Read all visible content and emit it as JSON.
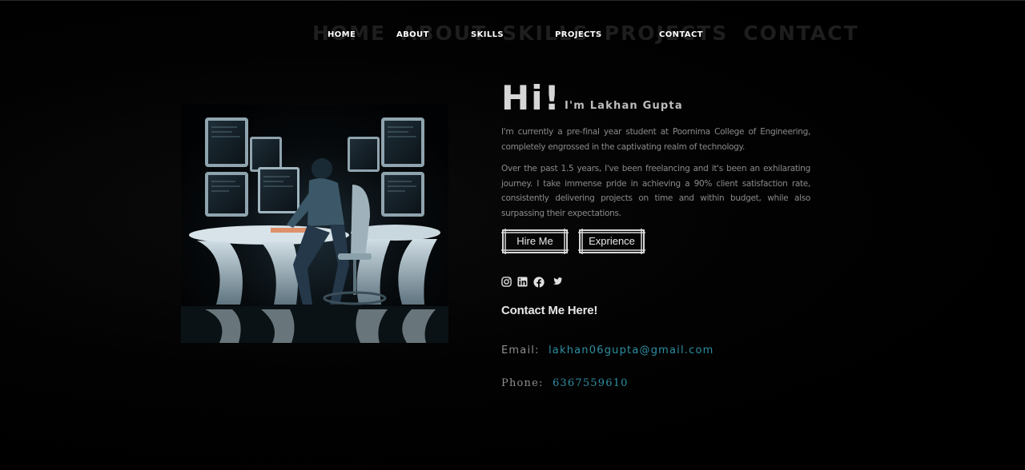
{
  "nav": {
    "ghost": [
      "HOME",
      "ABOUT",
      "SKILLS",
      "PROJECTS",
      "CONTACT"
    ],
    "links": [
      "HOME",
      "ABOUT",
      "SKILLS",
      "PROJECTS",
      "CONTACT"
    ]
  },
  "hero": {
    "greeting": "Hi!",
    "name": "I'm Lakhan Gupta",
    "paragraph1": "I'm currently a pre-final year student at Poornima College of Engineering, completely engrossed in the captivating realm of technology.",
    "paragraph2": "Over the past 1.5 years, I've been freelancing and it's been an exhilarating journey. I take immense pride in achieving a 90% client satisfaction rate, consistently delivering projects on time and within budget, while also surpassing their expectations.",
    "buttons": {
      "hire": "Hire Me",
      "experience": "Exprience"
    },
    "socials": [
      "instagram-icon",
      "linkedin-icon",
      "facebook-icon",
      "twitter-icon"
    ]
  },
  "contact": {
    "heading": "Contact Me Here!",
    "email_label": "Email:",
    "email_value": "lakhan06gupta@gmail.com",
    "phone_label": "Phone:",
    "phone_value": "6367559610"
  },
  "colors": {
    "background": "#000000",
    "accent": "#2f8fa3",
    "text_muted": "#8a8a8a"
  }
}
